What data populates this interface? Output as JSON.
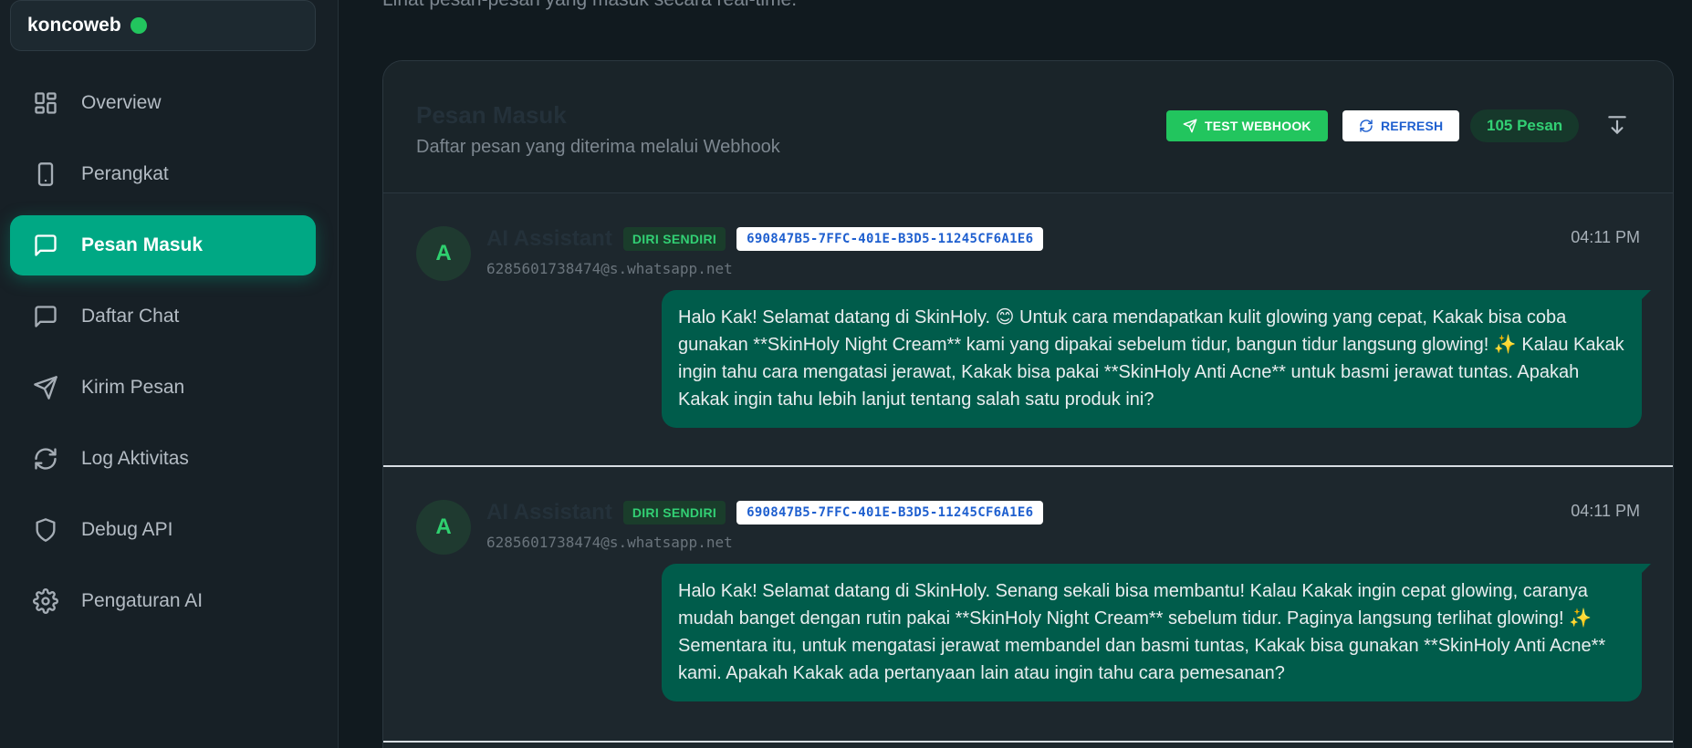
{
  "brand": {
    "name": "koncoweb",
    "status_color": "#22c55e"
  },
  "sidebar": {
    "items": [
      {
        "label": "Overview",
        "icon": "grid-icon"
      },
      {
        "label": "Perangkat",
        "icon": "phone-icon"
      },
      {
        "label": "Pesan Masuk",
        "icon": "message-icon",
        "active": true
      },
      {
        "label": "Daftar Chat",
        "icon": "chat-icon"
      },
      {
        "label": "Kirim Pesan",
        "icon": "send-icon"
      },
      {
        "label": "Log Aktivitas",
        "icon": "refresh-icon"
      },
      {
        "label": "Debug API",
        "icon": "shield-icon"
      },
      {
        "label": "Pengaturan AI",
        "icon": "gear-icon"
      }
    ]
  },
  "page": {
    "subtitle": "Lihat pesan-pesan yang masuk secara real-time."
  },
  "card": {
    "title": "Pesan Masuk",
    "subtitle": "Daftar pesan yang diterima melalui Webhook",
    "test_webhook_label": "TEST WEBHOOK",
    "refresh_label": "REFRESH",
    "count_label": "105 Pesan"
  },
  "messages": [
    {
      "avatar": "A",
      "sender": "AI Assistant",
      "tag": "DIRI SENDIRI",
      "id": "690847B5-7FFC-401E-B3D5-11245CF6A1E6",
      "jid": "6285601738474@s.whatsapp.net",
      "time": "04:11 PM",
      "text": "Halo Kak! Selamat datang di SkinHoly. 😊 Untuk cara mendapatkan kulit glowing yang cepat, Kakak bisa coba gunakan **SkinHoly Night Cream** kami yang dipakai sebelum tidur, bangun tidur langsung glowing! ✨ Kalau Kakak ingin tahu cara mengatasi jerawat, Kakak bisa pakai **SkinHoly Anti Acne** untuk basmi jerawat tuntas. Apakah Kakak ingin tahu lebih lanjut tentang salah satu produk ini?"
    },
    {
      "avatar": "A",
      "sender": "AI Assistant",
      "tag": "DIRI SENDIRI",
      "id": "690847B5-7FFC-401E-B3D5-11245CF6A1E6",
      "jid": "6285601738474@s.whatsapp.net",
      "time": "04:11 PM",
      "text": "Halo Kak! Selamat datang di SkinHoly. Senang sekali bisa membantu! Kalau Kakak ingin cepat glowing, caranya mudah banget dengan rutin pakai **SkinHoly Night Cream** sebelum tidur. Paginya langsung terlihat glowing! ✨ Sementara itu, untuk mengatasi jerawat membandel dan basmi tuntas, Kakak bisa gunakan **SkinHoly Anti Acne** kami. Apakah Kakak ada pertanyaan lain atau ingin tahu cara pemesanan?"
    }
  ]
}
